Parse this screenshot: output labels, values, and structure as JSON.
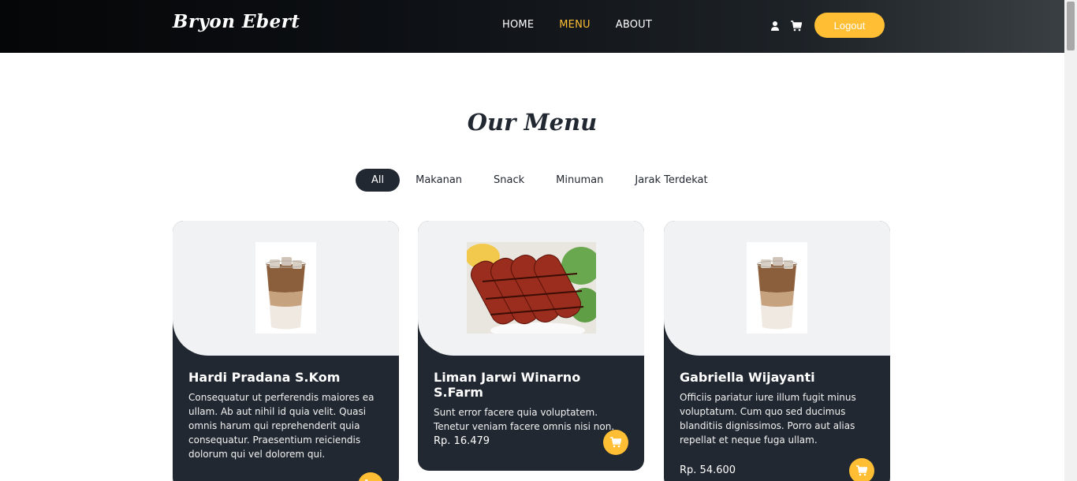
{
  "brand": "Bryon Ebert",
  "nav": [
    {
      "label": "HOME",
      "active": false
    },
    {
      "label": "MENU",
      "active": true
    },
    {
      "label": "ABOUT",
      "active": false
    }
  ],
  "header": {
    "logout_label": "Logout",
    "user_icon": "user-icon",
    "cart_icon": "cart-icon"
  },
  "section": {
    "title": "Our Menu"
  },
  "filters": [
    "All",
    "Makanan",
    "Snack",
    "Minuman",
    "Jarak Terdekat"
  ],
  "cards": [
    {
      "name": "Hardi Pradana S.Kom",
      "description": "Consequatur ut perferendis maiores ea ullam. Ab aut nihil id quia velit. Quasi omnis harum qui reprehenderit quia consequatur. Praesentium reiciendis dolorum qui vel dolorem qui.",
      "price": "",
      "image": "iced-coffee"
    },
    {
      "name": "Liman Jarwi Winarno S.Farm",
      "description": "Sunt error facere quia voluptatem. Tenetur veniam facere omnis nisi non.",
      "price": "Rp. 16.479",
      "image": "grilled-sausages"
    },
    {
      "name": "Gabriella Wijayanti",
      "description": "Officiis pariatur iure illum fugit minus voluptatum. Cum quo sed ducimus blanditiis dignissimos. Porro aut alias repellat et neque fuga ullam.",
      "price": "Rp. 54.600",
      "image": "iced-coffee"
    }
  ],
  "colors": {
    "accent": "#ffbe33",
    "dark": "#222831",
    "light": "#f1f2f3"
  }
}
